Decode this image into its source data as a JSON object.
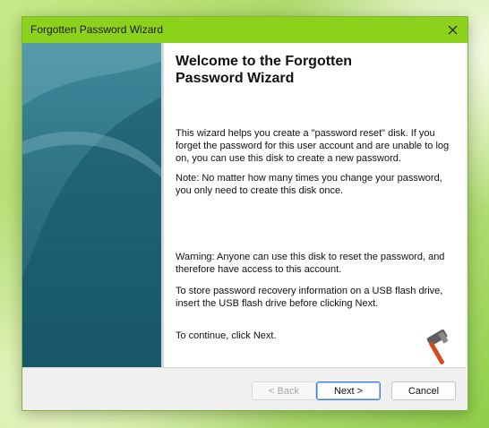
{
  "window": {
    "title": "Forgotten Password Wizard",
    "close_icon": "close-icon"
  },
  "content": {
    "heading": "Welcome to the Forgotten\nPassword Wizard",
    "para1": "This wizard helps you create a \"password reset\" disk. If you forget the password for this user account and are unable to log on, you can use this disk to create a new password.",
    "para2": "Note: No matter how many times you change your password, you only need to create this disk once.",
    "para3": "Warning: Anyone can use this disk to reset the password, and therefore have access to this account.",
    "para4": "To store password recovery information on a USB flash drive, insert the USB flash drive before clicking Next.",
    "para5": "To continue, click Next.",
    "logo_icon": "hammer-logo-icon"
  },
  "buttons": {
    "back": "< Back",
    "next": "Next >",
    "cancel": "Cancel"
  },
  "colors": {
    "titlebar": "#8cd21d",
    "side_panel": "#2f7487",
    "next_border": "#3b7fd2"
  }
}
